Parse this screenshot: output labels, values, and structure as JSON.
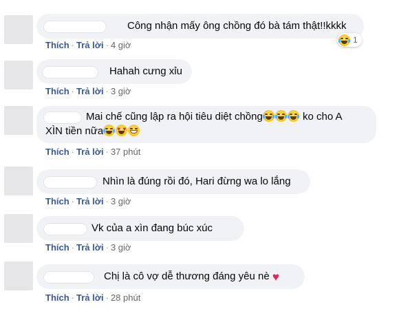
{
  "labels": {
    "like": "Thích",
    "reply": "Trả lời",
    "sep": "·"
  },
  "comments": [
    {
      "text": "Công nhận mấy ông chồng đó bà tám thật!!kkkk",
      "time": "4 giờ",
      "reaction_count": "1"
    },
    {
      "text": "Hahah cưng xỉu",
      "time": "3 giờ"
    },
    {
      "text_line1": "Mai chế cũng lập ra hội tiêu diệt chồng",
      "text_line1_tail": "ko cho A",
      "text_line2": "XÌN tiền nữa",
      "time": "37 phút"
    },
    {
      "text": "Nhìn là đúng rồi đó, Hari đừng wa lo lắng",
      "time": "3 giờ"
    },
    {
      "text": "Vk của a xìn đang búc xúc",
      "time": "3 giờ"
    },
    {
      "text": "Chị là cô vợ dễ thương đáng yêu nè",
      "time": "28 phút"
    }
  ],
  "icons": [
    "laughing-tears-emoji",
    "heart-eyes-emoji",
    "grinning-emoji",
    "red-heart-emoji"
  ]
}
